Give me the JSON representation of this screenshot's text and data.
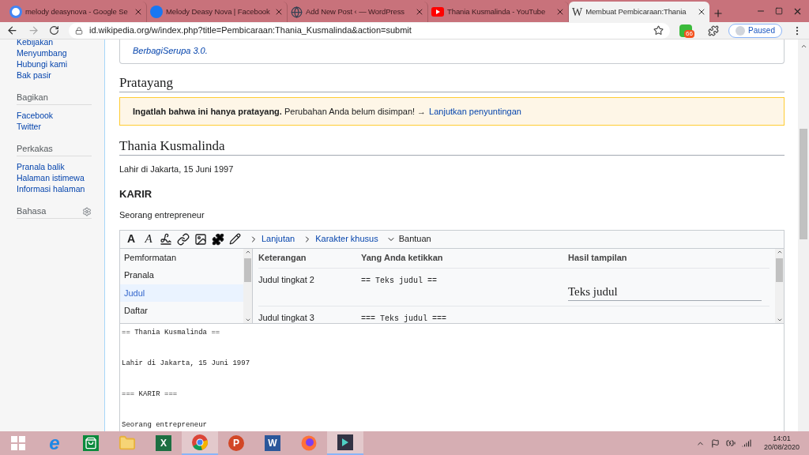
{
  "browser": {
    "tabs": [
      {
        "title": "melody deasynova - Google Se",
        "kind": "google",
        "selected": false
      },
      {
        "title": "Melody Deasy Nova | Facebook",
        "kind": "facebook",
        "selected": false
      },
      {
        "title": "Add New Post ‹ — WordPress",
        "kind": "globe",
        "selected": false
      },
      {
        "title": "Thania Kusmalinda - YouTube",
        "kind": "youtube",
        "selected": false
      },
      {
        "title": "Membuat Pembicaraan:Thania",
        "kind": "wikipedia",
        "favicon": "W",
        "selected": true
      }
    ],
    "url": "id.wikipedia.org/w/index.php?title=Pembicaraan:Thania_Kusmalinda&action=submit",
    "extension_badge": "66",
    "profile_label": "Paused"
  },
  "sidebar": {
    "groups": [
      {
        "items": [
          "Kebijakan",
          "Menyumbang",
          "Hubungi kami",
          "Bak pasir"
        ]
      },
      {
        "heading": "Bagikan",
        "items": [
          "Facebook",
          "Twitter"
        ]
      },
      {
        "heading": "Perkakas",
        "items": [
          "Pranala balik",
          "Halaman istimewa",
          "Informasi halaman"
        ]
      },
      {
        "heading": "Bahasa",
        "settings": true
      }
    ]
  },
  "license_box": {
    "link": "BerbagiSerupa 3.0."
  },
  "preview": {
    "heading": "Pratayang",
    "warning_bold": "Ingatlah bahwa ini hanya pratayang.",
    "warning_text": "Perubahan Anda belum disimpan! →",
    "warning_link": "Lanjutkan penyuntingan"
  },
  "article": {
    "title": "Thania Kusmalinda",
    "intro": "Lahir di Jakarta, 15 Juni 1997",
    "section": "KARIR",
    "section_text": "Seorang entrepreneur"
  },
  "editor": {
    "toolbar": {
      "bold_label": "A",
      "italic_label": "A",
      "menus": [
        {
          "label": "Lanjutan",
          "expanded": false
        },
        {
          "label": "Karakter khusus",
          "expanded": false
        },
        {
          "label": "Bantuan",
          "expanded": true
        }
      ]
    },
    "help": {
      "sections": [
        {
          "label": "Pemformatan",
          "selected": false
        },
        {
          "label": "Pranala",
          "selected": false
        },
        {
          "label": "Judul",
          "selected": true
        },
        {
          "label": "Daftar",
          "selected": false
        }
      ],
      "columns": [
        "Keterangan",
        "Yang Anda ketikkan",
        "Hasil tampilan"
      ],
      "rows": [
        {
          "description": "Judul tingkat 2",
          "typed": "== Teks judul ==",
          "result": "Teks judul"
        },
        {
          "description": "Judul tingkat 3",
          "typed": "=== Teks judul ==="
        }
      ]
    },
    "text_lines": [
      "== Thania Kusmalinda ==",
      "Lahir di Jakarta, 15 Juni 1997",
      "=== KARIR ===",
      "Seorang entrepreneur"
    ]
  },
  "taskbar": {
    "apps": [
      {
        "kind": "windows",
        "selected": false
      },
      {
        "kind": "edge",
        "letter": "e",
        "selected": false
      },
      {
        "kind": "store",
        "selected": false
      },
      {
        "kind": "explorer",
        "selected": false
      },
      {
        "kind": "excel",
        "letter": "X",
        "selected": false
      },
      {
        "kind": "chrome",
        "selected": true
      },
      {
        "kind": "powerpoint",
        "letter": "P",
        "selected": false
      },
      {
        "kind": "word",
        "letter": "W",
        "selected": false
      },
      {
        "kind": "firefox",
        "selected": false
      },
      {
        "kind": "filmora",
        "selected": true
      }
    ],
    "time": "14:01",
    "date": "20/08/2020"
  }
}
